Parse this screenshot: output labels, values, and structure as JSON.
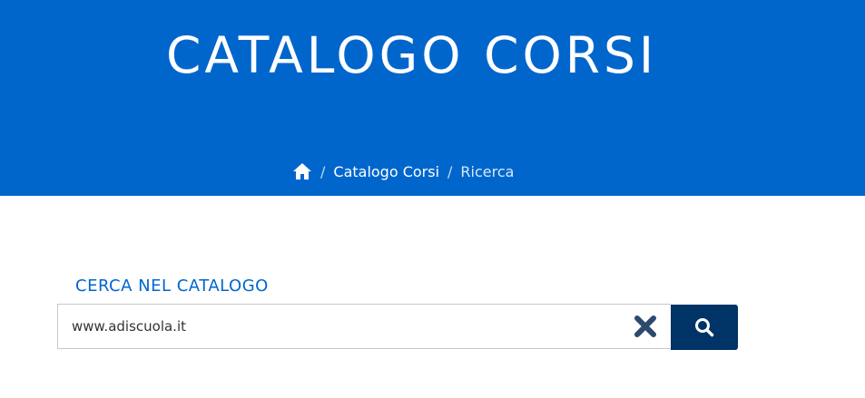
{
  "hero": {
    "title": "CATALOGO CORSI",
    "background_color": "#0066cc"
  },
  "breadcrumb": {
    "home_icon": "home-icon",
    "separator": "/",
    "items": [
      {
        "label": "Catalogo Corsi"
      },
      {
        "label": "Ricerca"
      }
    ]
  },
  "search": {
    "label": "CERCA NEL CATALOGO",
    "value": "www.adiscuola.it",
    "clear_icon": "close-icon",
    "search_icon": "search-icon",
    "label_color": "#0066cc",
    "button_color": "#003366"
  }
}
